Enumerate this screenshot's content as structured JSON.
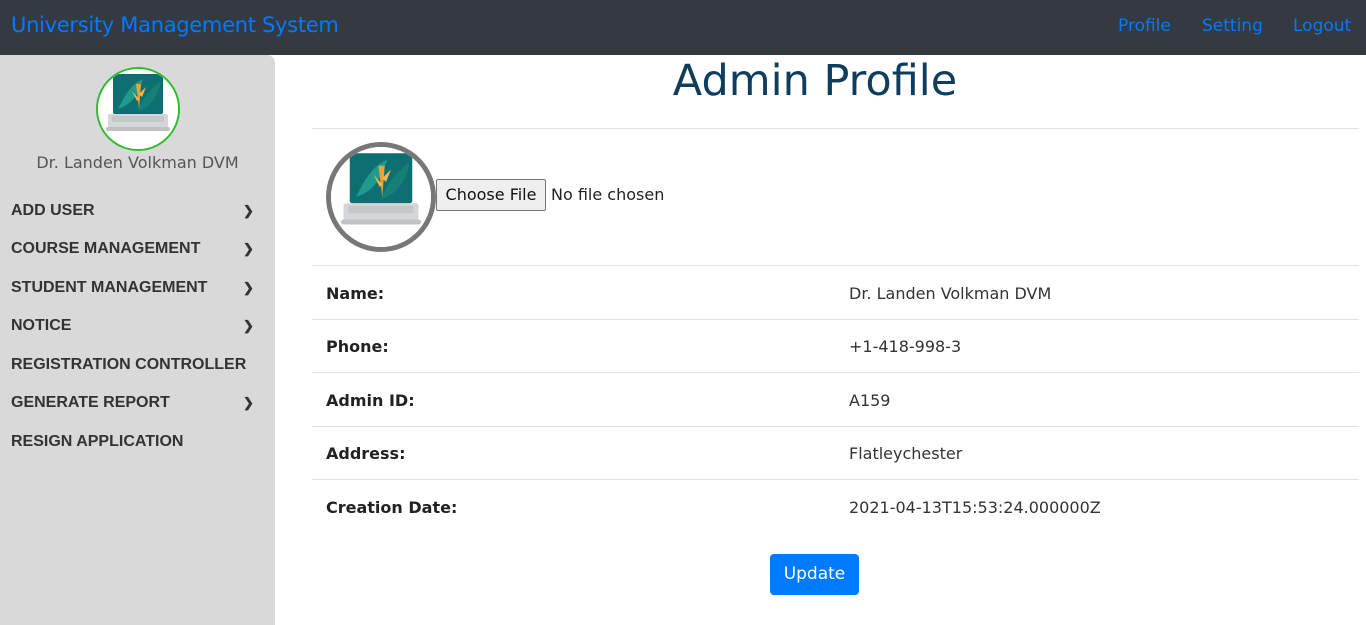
{
  "navbar": {
    "brand": "University Management System",
    "links": [
      "Profile",
      "Setting",
      "Logout"
    ]
  },
  "sidebar": {
    "user_name": "Dr. Landen Volkman DVM",
    "items": [
      {
        "label": "ADD USER",
        "has_submenu": true
      },
      {
        "label": "COURSE MANAGEMENT",
        "has_submenu": true
      },
      {
        "label": "STUDENT MANAGEMENT",
        "has_submenu": true
      },
      {
        "label": "NOTICE",
        "has_submenu": true
      },
      {
        "label": "REGISTRATION CONTROLLER",
        "has_submenu": false
      },
      {
        "label": "GENERATE REPORT",
        "has_submenu": true
      },
      {
        "label": "RESIGN APPLICATION",
        "has_submenu": false
      }
    ],
    "chevron_glyph": "❯"
  },
  "main": {
    "title": "Admin Profile",
    "file_input": {
      "button": "Choose File",
      "status": "No file chosen"
    },
    "details": [
      {
        "label": "Name:",
        "value": "Dr. Landen Volkman DVM"
      },
      {
        "label": "Phone:",
        "value": "+1-418-998-3"
      },
      {
        "label": "Admin ID:",
        "value": "A159"
      },
      {
        "label": "Address:",
        "value": "Flatleychester"
      },
      {
        "label": "Creation Date:",
        "value": "2021-04-13T15:53:24.000000Z"
      }
    ],
    "update_button": "Update"
  },
  "colors": {
    "navbar_bg": "#343a40",
    "accent": "#007bff",
    "sidebar_bg": "#d9d9d9",
    "title": "#0f3d5e",
    "avatar_ring_small": "#2ebc2e"
  },
  "icons": {
    "avatar": "laptop-image"
  }
}
